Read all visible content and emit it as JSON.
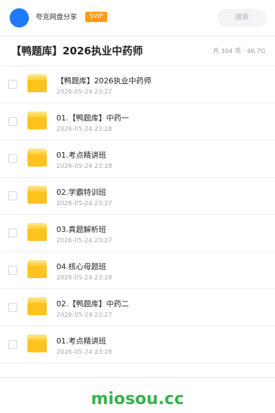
{
  "header": {
    "app_name": "夸克网盘分享",
    "badge": "SVIP",
    "search_label": "搜索",
    "avatar_color": "#1e7bff",
    "badge_color": "#ff9c1a"
  },
  "folder": {
    "title": "【鸭题库】2026执业中药师",
    "meta": "共 304 项 · 46.7G"
  },
  "items": [
    {
      "name": "【鸭题库】2026执业中药师",
      "date": "2026-05-24 23:27",
      "icon": "folder-icon"
    },
    {
      "name": "01.【鸭题库】中药一",
      "date": "2026-05-24 23:28",
      "icon": "folder-icon"
    },
    {
      "name": "01.考点精讲班",
      "date": "2026-05-24 23:28",
      "icon": "folder-icon"
    },
    {
      "name": "02.学霸特训班",
      "date": "2026-05-24 23:27",
      "icon": "folder-icon"
    },
    {
      "name": "03.真题解析班",
      "date": "2026-05-24 23:27",
      "icon": "folder-icon"
    },
    {
      "name": "04.核心母题班",
      "date": "2026-05-24 23:28",
      "icon": "folder-icon"
    },
    {
      "name": "02.【鸭题库】中药二",
      "date": "2026-05-24 23:27",
      "icon": "folder-icon"
    },
    {
      "name": "01.考点精讲班",
      "date": "2026-05-24 23:28",
      "icon": "folder-icon"
    }
  ],
  "footer": {
    "brand": "miosou.cc",
    "brand_color": "#35b34a"
  }
}
